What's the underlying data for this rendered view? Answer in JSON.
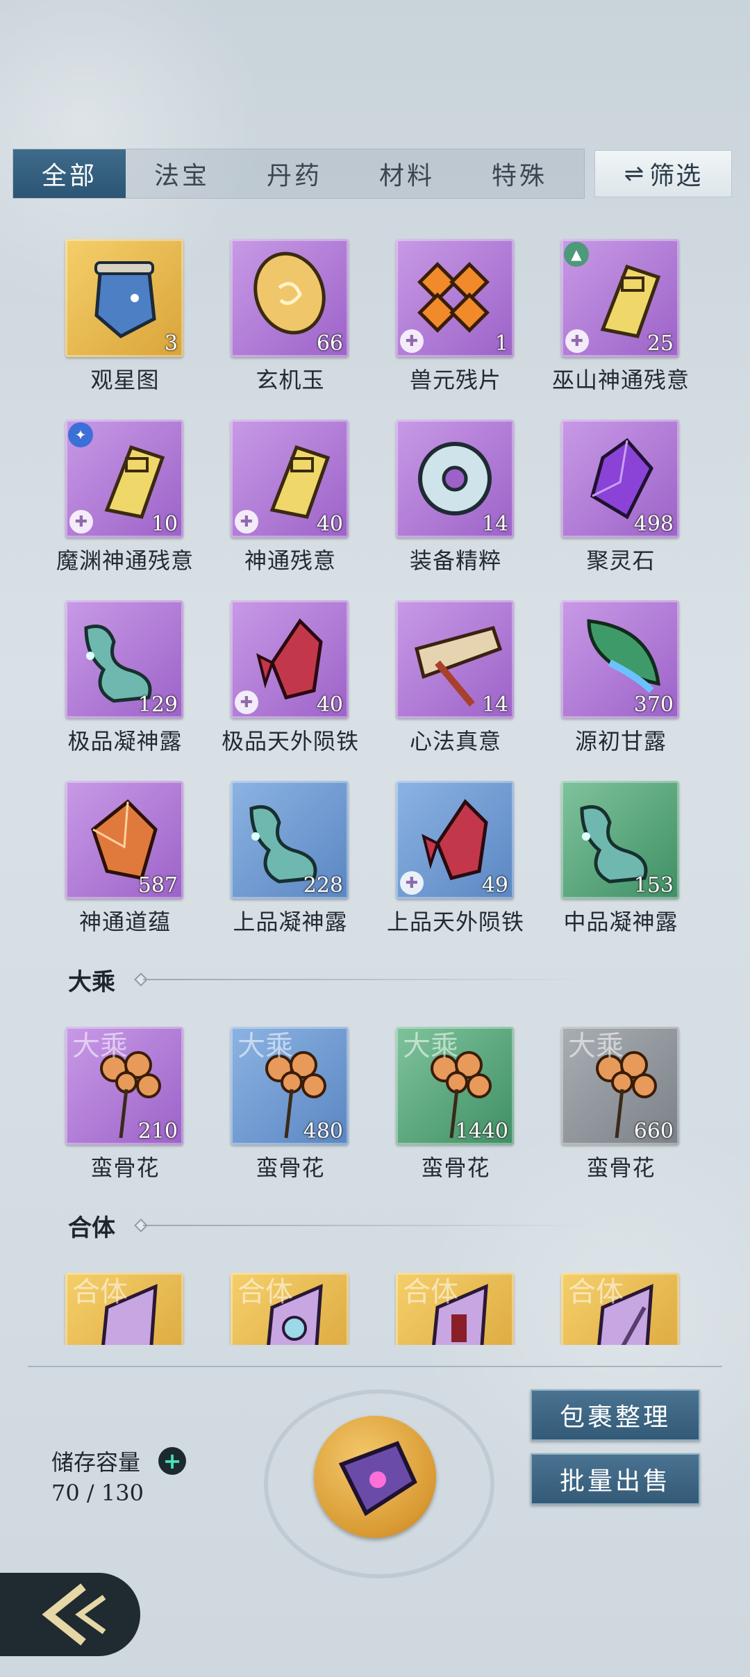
{
  "tabs": {
    "all": "全部",
    "fabao": "法宝",
    "danyao": "丹药",
    "cailiao": "材料",
    "teshu": "特殊",
    "filter": "筛选"
  },
  "items": [
    {
      "name": "观星图",
      "count": "3",
      "rarity": "gold",
      "icon": "star-map-icon"
    },
    {
      "name": "玄机玉",
      "count": "66",
      "rarity": "purple",
      "icon": "jade-icon"
    },
    {
      "name": "兽元残片",
      "count": "1",
      "rarity": "purple",
      "icon": "beast-fragment-icon"
    },
    {
      "name": "巫山神通残意",
      "count": "25",
      "rarity": "purple",
      "icon": "scroll-fragment-icon"
    },
    {
      "name": "魔渊神通残意",
      "count": "10",
      "rarity": "purple",
      "icon": "scroll-fragment-icon"
    },
    {
      "name": "神通残意",
      "count": "40",
      "rarity": "purple",
      "icon": "scroll-fragment-icon"
    },
    {
      "name": "装备精粹",
      "count": "14",
      "rarity": "purple",
      "icon": "ring-essence-icon"
    },
    {
      "name": "聚灵石",
      "count": "498",
      "rarity": "purple",
      "icon": "spirit-crystal-icon"
    },
    {
      "name": "极品凝神露",
      "count": "129",
      "rarity": "purple",
      "icon": "dew-gourd-icon"
    },
    {
      "name": "极品天外陨铁",
      "count": "40",
      "rarity": "purple",
      "icon": "meteor-iron-icon"
    },
    {
      "name": "心法真意",
      "count": "14",
      "rarity": "purple",
      "icon": "mind-scroll-icon"
    },
    {
      "name": "源初甘露",
      "count": "370",
      "rarity": "purple",
      "icon": "leaf-dew-icon"
    },
    {
      "name": "神通道蕴",
      "count": "587",
      "rarity": "purple",
      "icon": "amber-crystal-icon"
    },
    {
      "name": "上品凝神露",
      "count": "228",
      "rarity": "blue",
      "icon": "dew-gourd-icon"
    },
    {
      "name": "上品天外陨铁",
      "count": "49",
      "rarity": "blue",
      "icon": "meteor-iron-icon"
    },
    {
      "name": "中品凝神露",
      "count": "153",
      "rarity": "green",
      "icon": "dew-gourd-icon"
    }
  ],
  "sections": {
    "dacheng": {
      "title": "大乘",
      "items": [
        {
          "name": "蛮骨花",
          "count": "210",
          "rarity": "purple",
          "tier": "大乘",
          "icon": "flower-icon"
        },
        {
          "name": "蛮骨花",
          "count": "480",
          "rarity": "blue",
          "tier": "大乘",
          "icon": "flower-icon"
        },
        {
          "name": "蛮骨花",
          "count": "1440",
          "rarity": "green",
          "tier": "大乘",
          "icon": "flower-icon"
        },
        {
          "name": "蛮骨花",
          "count": "660",
          "rarity": "gray",
          "tier": "大乘",
          "icon": "flower-icon"
        }
      ]
    },
    "heti": {
      "title": "合体",
      "items": [
        {
          "tier": "合体",
          "rarity": "gold",
          "icon": "crystal-beast-icon"
        },
        {
          "tier": "合体",
          "rarity": "gold",
          "icon": "crystal-ring-icon"
        },
        {
          "tier": "合体",
          "rarity": "gold",
          "icon": "crystal-figure-icon"
        },
        {
          "tier": "合体",
          "rarity": "gold",
          "icon": "crystal-blade-icon"
        }
      ]
    }
  },
  "footer": {
    "capacity_label": "储存容量",
    "capacity_value": "70 / 130",
    "organize_button": "包裹整理",
    "bulk_sell_button": "批量出售"
  },
  "colors": {
    "accent_tab": "#2c5574",
    "rarity_gold": "#e1b04a",
    "rarity_purple": "#b07ed8",
    "rarity_blue": "#6f9bd3",
    "rarity_green": "#5aa57d",
    "rarity_gray": "#90969c"
  }
}
